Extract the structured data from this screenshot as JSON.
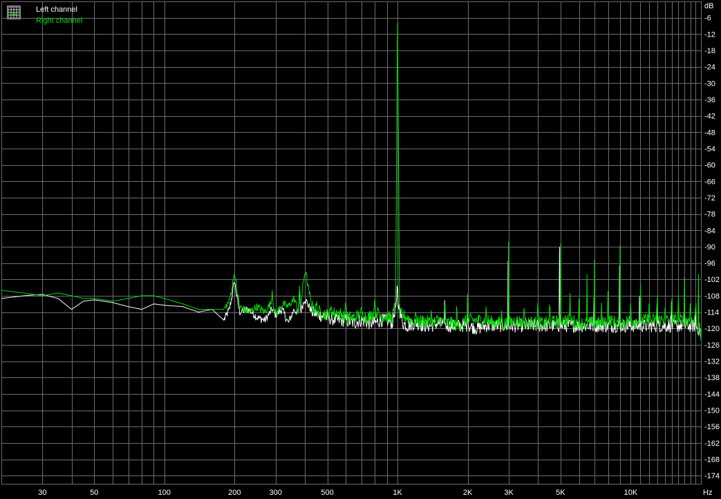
{
  "chart_data": {
    "type": "line",
    "title": "",
    "xlabel": "",
    "ylabel": "",
    "x_unit": "Hz",
    "y_unit": "dB",
    "x_scale": "log",
    "xlim": [
      20,
      20000
    ],
    "ylim": [
      -177,
      0
    ],
    "grid": true,
    "legend_position": "top-left",
    "background": "#000000",
    "grid_color": "#6e6e6e",
    "x_ticks": [
      30,
      50,
      100,
      200,
      300,
      500,
      1000,
      2000,
      3000,
      5000,
      10000
    ],
    "x_tick_labels": [
      "30",
      "50",
      "100",
      "200",
      "300",
      "500",
      "1K",
      "2K",
      "3K",
      "5K",
      "10K"
    ],
    "y_ticks": [
      -6,
      -12,
      -18,
      -24,
      -30,
      -36,
      -42,
      -48,
      -54,
      -60,
      -66,
      -72,
      -78,
      -84,
      -90,
      -96,
      -102,
      -108,
      -114,
      -120,
      -126,
      -132,
      -138,
      -144,
      -150,
      -156,
      -162,
      -168,
      -174
    ],
    "y_tick_labels": [
      "-6",
      "-12",
      "-18",
      "-24",
      "-30",
      "-36",
      "-42",
      "-48",
      "-54",
      "-60",
      "-66",
      "-72",
      "-78",
      "-84",
      "-90",
      "-96",
      "-102",
      "-108",
      "-114",
      "-120",
      "-126",
      "-132",
      "-138",
      "-144",
      "-150",
      "-156",
      "-162",
      "-168",
      "-174"
    ],
    "series": [
      {
        "name": "Left channel",
        "color": "#ffffff",
        "x": [
          20,
          25,
          30,
          35,
          40,
          45,
          50,
          60,
          70,
          80,
          90,
          100,
          120,
          140,
          160,
          180,
          190,
          200,
          210,
          230,
          250,
          270,
          290,
          300,
          320,
          340,
          360,
          380,
          400,
          430,
          460,
          500,
          550,
          600,
          650,
          700,
          750,
          800,
          850,
          900,
          950,
          980,
          1000,
          1020,
          1050,
          1100,
          1200,
          1300,
          1400,
          1500,
          1600,
          1700,
          1800,
          1900,
          2000,
          2200,
          2400,
          2600,
          2800,
          3000,
          3200,
          3500,
          3800,
          4000,
          4500,
          5000,
          5500,
          6000,
          6500,
          7000,
          7500,
          8000,
          9000,
          10000,
          11000,
          12000,
          13000,
          14000,
          15000,
          16000,
          17000,
          18000,
          19000,
          20000
        ],
        "y": [
          -109,
          -108,
          -107.5,
          -109,
          -113,
          -110,
          -109.5,
          -110.5,
          -112,
          -113,
          -111,
          -111.5,
          -112,
          -114,
          -113,
          -117,
          -113,
          -103,
          -114,
          -113,
          -116,
          -117,
          -113,
          -115,
          -113,
          -118,
          -113,
          -115,
          -109,
          -114,
          -115,
          -116,
          -117,
          -117,
          -118,
          -117,
          -118,
          -118,
          -117,
          -117,
          -118,
          -112,
          -110,
          -113,
          -118,
          -119,
          -118,
          -119,
          -119,
          -118,
          -119,
          -119,
          -119,
          -119,
          -119,
          -120,
          -119,
          -119,
          -119,
          -119,
          -119,
          -119,
          -119,
          -119,
          -119,
          -119,
          -119,
          -119,
          -119,
          -119,
          -119,
          -119,
          -119,
          -119,
          -119,
          -119,
          -119,
          -119,
          -119,
          -119,
          -119,
          -119,
          -119,
          -121
        ]
      },
      {
        "name": "Right channel",
        "color": "#00dd00",
        "x": [
          20,
          25,
          30,
          35,
          40,
          45,
          50,
          60,
          70,
          80,
          90,
          100,
          120,
          140,
          160,
          180,
          190,
          200,
          210,
          230,
          250,
          270,
          290,
          300,
          320,
          340,
          360,
          380,
          400,
          430,
          460,
          500,
          550,
          600,
          650,
          700,
          750,
          800,
          850,
          900,
          950,
          980,
          1000,
          1020,
          1050,
          1100,
          1200,
          1300,
          1400,
          1500,
          1600,
          1700,
          1800,
          1900,
          2000,
          2200,
          2400,
          2600,
          2800,
          3000,
          3200,
          3500,
          3800,
          4000,
          4500,
          5000,
          5500,
          6000,
          6500,
          7000,
          7500,
          8000,
          9000,
          10000,
          11000,
          12000,
          13000,
          14000,
          15000,
          16000,
          17000,
          18000,
          19000,
          20000
        ],
        "y": [
          -106,
          -107,
          -108,
          -107,
          -108,
          -109,
          -109,
          -110,
          -109,
          -108,
          -108,
          -109,
          -111,
          -113,
          -113,
          -113,
          -110,
          -100,
          -112,
          -114,
          -112,
          -114,
          -110,
          -115,
          -111,
          -112,
          -109,
          -115,
          -99,
          -112,
          -114,
          -115,
          -114,
          -116,
          -116,
          -115,
          -116,
          -114,
          -115,
          -116,
          -116,
          -111,
          -5,
          -115,
          -115,
          -116,
          -118,
          -117,
          -118,
          -117,
          -118,
          -118,
          -119,
          -118,
          -117,
          -117,
          -117,
          -118,
          -118,
          -118,
          -117,
          -118,
          -118,
          -118,
          -118,
          -117,
          -117,
          -118,
          -118,
          -118,
          -118,
          -117,
          -118,
          -117,
          -117,
          -117,
          -117,
          -117,
          -117,
          -117,
          -117,
          -117,
          -117,
          -123
        ]
      }
    ],
    "peaks": {
      "left": [
        {
          "x": 199,
          "y": -103
        },
        {
          "x": 380,
          "y": -104
        },
        {
          "x": 998,
          "y": -99
        },
        {
          "x": 1590,
          "y": -107
        },
        {
          "x": 2000,
          "y": -104
        },
        {
          "x": 2980,
          "y": -90
        },
        {
          "x": 4950,
          "y": -90
        },
        {
          "x": 6950,
          "y": -104
        },
        {
          "x": 8950,
          "y": -96
        },
        {
          "x": 10900,
          "y": -108
        },
        {
          "x": 12950,
          "y": -110
        },
        {
          "x": 14950,
          "y": -110
        },
        {
          "x": 16950,
          "y": -110
        },
        {
          "x": 18950,
          "y": -112
        }
      ],
      "right": [
        {
          "x": 199,
          "y": -100
        },
        {
          "x": 290,
          "y": -106
        },
        {
          "x": 380,
          "y": -103
        },
        {
          "x": 405,
          "y": -99
        },
        {
          "x": 450,
          "y": -110
        },
        {
          "x": 520,
          "y": -111
        },
        {
          "x": 600,
          "y": -109
        },
        {
          "x": 700,
          "y": -112
        },
        {
          "x": 798,
          "y": -109
        },
        {
          "x": 1198,
          "y": -107
        },
        {
          "x": 1395,
          "y": -109
        },
        {
          "x": 1595,
          "y": -103
        },
        {
          "x": 1795,
          "y": -107
        },
        {
          "x": 1995,
          "y": -105
        },
        {
          "x": 2395,
          "y": -111
        },
        {
          "x": 2795,
          "y": -112
        },
        {
          "x": 2995,
          "y": -81
        },
        {
          "x": 3495,
          "y": -105
        },
        {
          "x": 3995,
          "y": -104
        },
        {
          "x": 4495,
          "y": -104
        },
        {
          "x": 4995,
          "y": -82
        },
        {
          "x": 5495,
          "y": -104
        },
        {
          "x": 5995,
          "y": -107
        },
        {
          "x": 6495,
          "y": -99
        },
        {
          "x": 6995,
          "y": -92
        },
        {
          "x": 7495,
          "y": -110
        },
        {
          "x": 7995,
          "y": -103
        },
        {
          "x": 8995,
          "y": -88
        },
        {
          "x": 9995,
          "y": -105
        },
        {
          "x": 10995,
          "y": -98
        },
        {
          "x": 11995,
          "y": -104
        },
        {
          "x": 12995,
          "y": -101
        },
        {
          "x": 13995,
          "y": -108
        },
        {
          "x": 14995,
          "y": -101
        },
        {
          "x": 15995,
          "y": -102
        },
        {
          "x": 16995,
          "y": -101
        },
        {
          "x": 17995,
          "y": -103
        },
        {
          "x": 18995,
          "y": -104
        },
        {
          "x": 19500,
          "y": -96
        }
      ]
    }
  },
  "legend": {
    "left_label": "Left channel",
    "right_label": "Right channel",
    "icon": "grid-chart-icon"
  },
  "axes": {
    "x_unit": "Hz",
    "y_unit": "dB"
  }
}
